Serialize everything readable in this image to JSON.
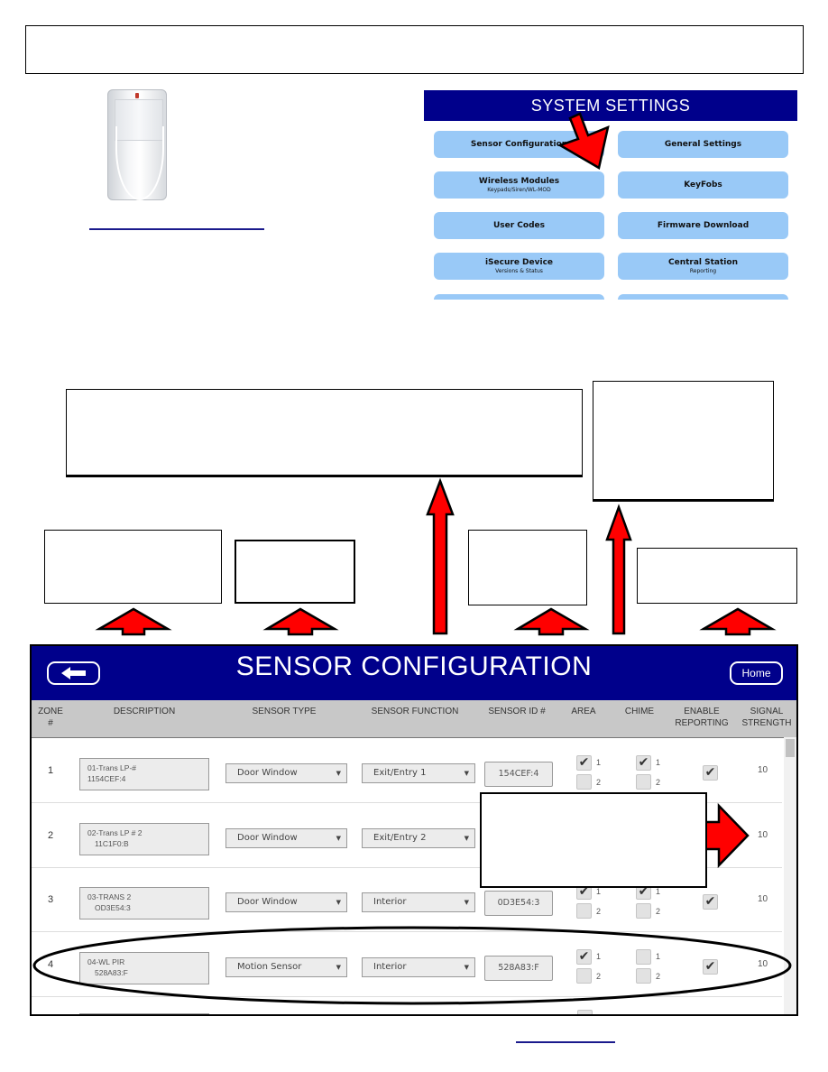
{
  "device_image": {
    "name": "wireless PIR motion sensor",
    "led_color": "#c0392b"
  },
  "system_settings": {
    "title": "SYSTEM SETTINGS",
    "header_color": "#00008b",
    "button_color": "#99c9f7",
    "buttons": [
      {
        "label": "Sensor Configuration",
        "sub": ""
      },
      {
        "label": "General Settings",
        "sub": ""
      },
      {
        "label": "Wireless Modules",
        "sub": "Keypads/Siren/WL-MOD"
      },
      {
        "label": "KeyFobs",
        "sub": ""
      },
      {
        "label": "User Codes",
        "sub": ""
      },
      {
        "label": "Firmware Download",
        "sub": ""
      },
      {
        "label": "iSecure Device",
        "sub": "Versions & Status"
      },
      {
        "label": "Central Station",
        "sub": "Reporting"
      }
    ]
  },
  "annotations": {
    "arrow_color": "#ff0000"
  },
  "sensor_configuration": {
    "title": "SENSOR CONFIGURATION",
    "back_icon": "arrow-left-icon",
    "home_label": "Home",
    "columns": {
      "zone": [
        "ZONE",
        "#"
      ],
      "description": "DESCRIPTION",
      "sensor_type": "SENSOR TYPE",
      "sensor_function": "SENSOR FUNCTION",
      "sensor_id": "SENSOR ID #",
      "area": "AREA",
      "chime": "CHIME",
      "enable_reporting": [
        "ENABLE",
        "REPORTING"
      ],
      "signal_strength": [
        "SIGNAL",
        "STRENGTH"
      ]
    },
    "rows": [
      {
        "zone": "1",
        "desc1": "01-Trans LP-#",
        "desc2": "1154CEF:4",
        "type": "Door Window",
        "function": "Exit/Entry 1",
        "id": "154CEF:4",
        "area1": true,
        "area2": false,
        "chime1": true,
        "chime2": false,
        "reporting": true,
        "signal": "10"
      },
      {
        "zone": "2",
        "desc1": "02-Trans LP # 2",
        "desc2": "11C1F0:B",
        "type": "Door Window",
        "function": "Exit/Entry 2",
        "id": "",
        "area1": false,
        "area2": false,
        "chime1": false,
        "chime2": false,
        "reporting": false,
        "signal": "10"
      },
      {
        "zone": "3",
        "desc1": "03-TRANS 2",
        "desc2": "OD3E54:3",
        "type": "Door Window",
        "function": "Interior",
        "id": "0D3E54:3",
        "area1": true,
        "area2": false,
        "chime1": true,
        "chime2": false,
        "reporting": true,
        "signal": "10"
      },
      {
        "zone": "4",
        "desc1": "04-WL PIR",
        "desc2": "528A83:F",
        "type": "Motion Sensor",
        "function": "Interior",
        "id": "528A83:F",
        "area1": true,
        "area2": false,
        "chime1": false,
        "chime2": false,
        "reporting": true,
        "signal": "10"
      }
    ],
    "checkbox_labels": {
      "one": "1",
      "two": "2"
    },
    "check_glyph": "✔",
    "caret_glyph": "▼"
  }
}
